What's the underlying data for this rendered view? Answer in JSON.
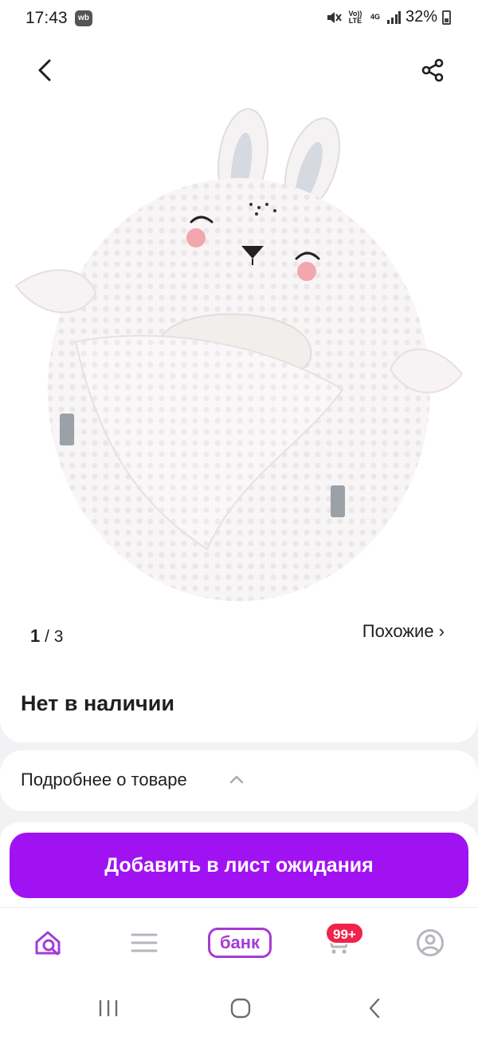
{
  "status": {
    "time": "17:43",
    "app_badge": "wb",
    "volte": "Vo)) LTE",
    "network": "4G",
    "battery": "32%"
  },
  "gallery": {
    "current": "1",
    "separator": "/",
    "total": "3",
    "similar_label": "Похожие ›"
  },
  "product": {
    "availability": "Нет в наличии",
    "details_label": "Подробнее о товаре"
  },
  "cta": {
    "label": "Добавить в лист ожидания"
  },
  "tabbar": {
    "bank_label": "банк",
    "cart_badge": "99+",
    "accent_color": "#a53bd5"
  }
}
